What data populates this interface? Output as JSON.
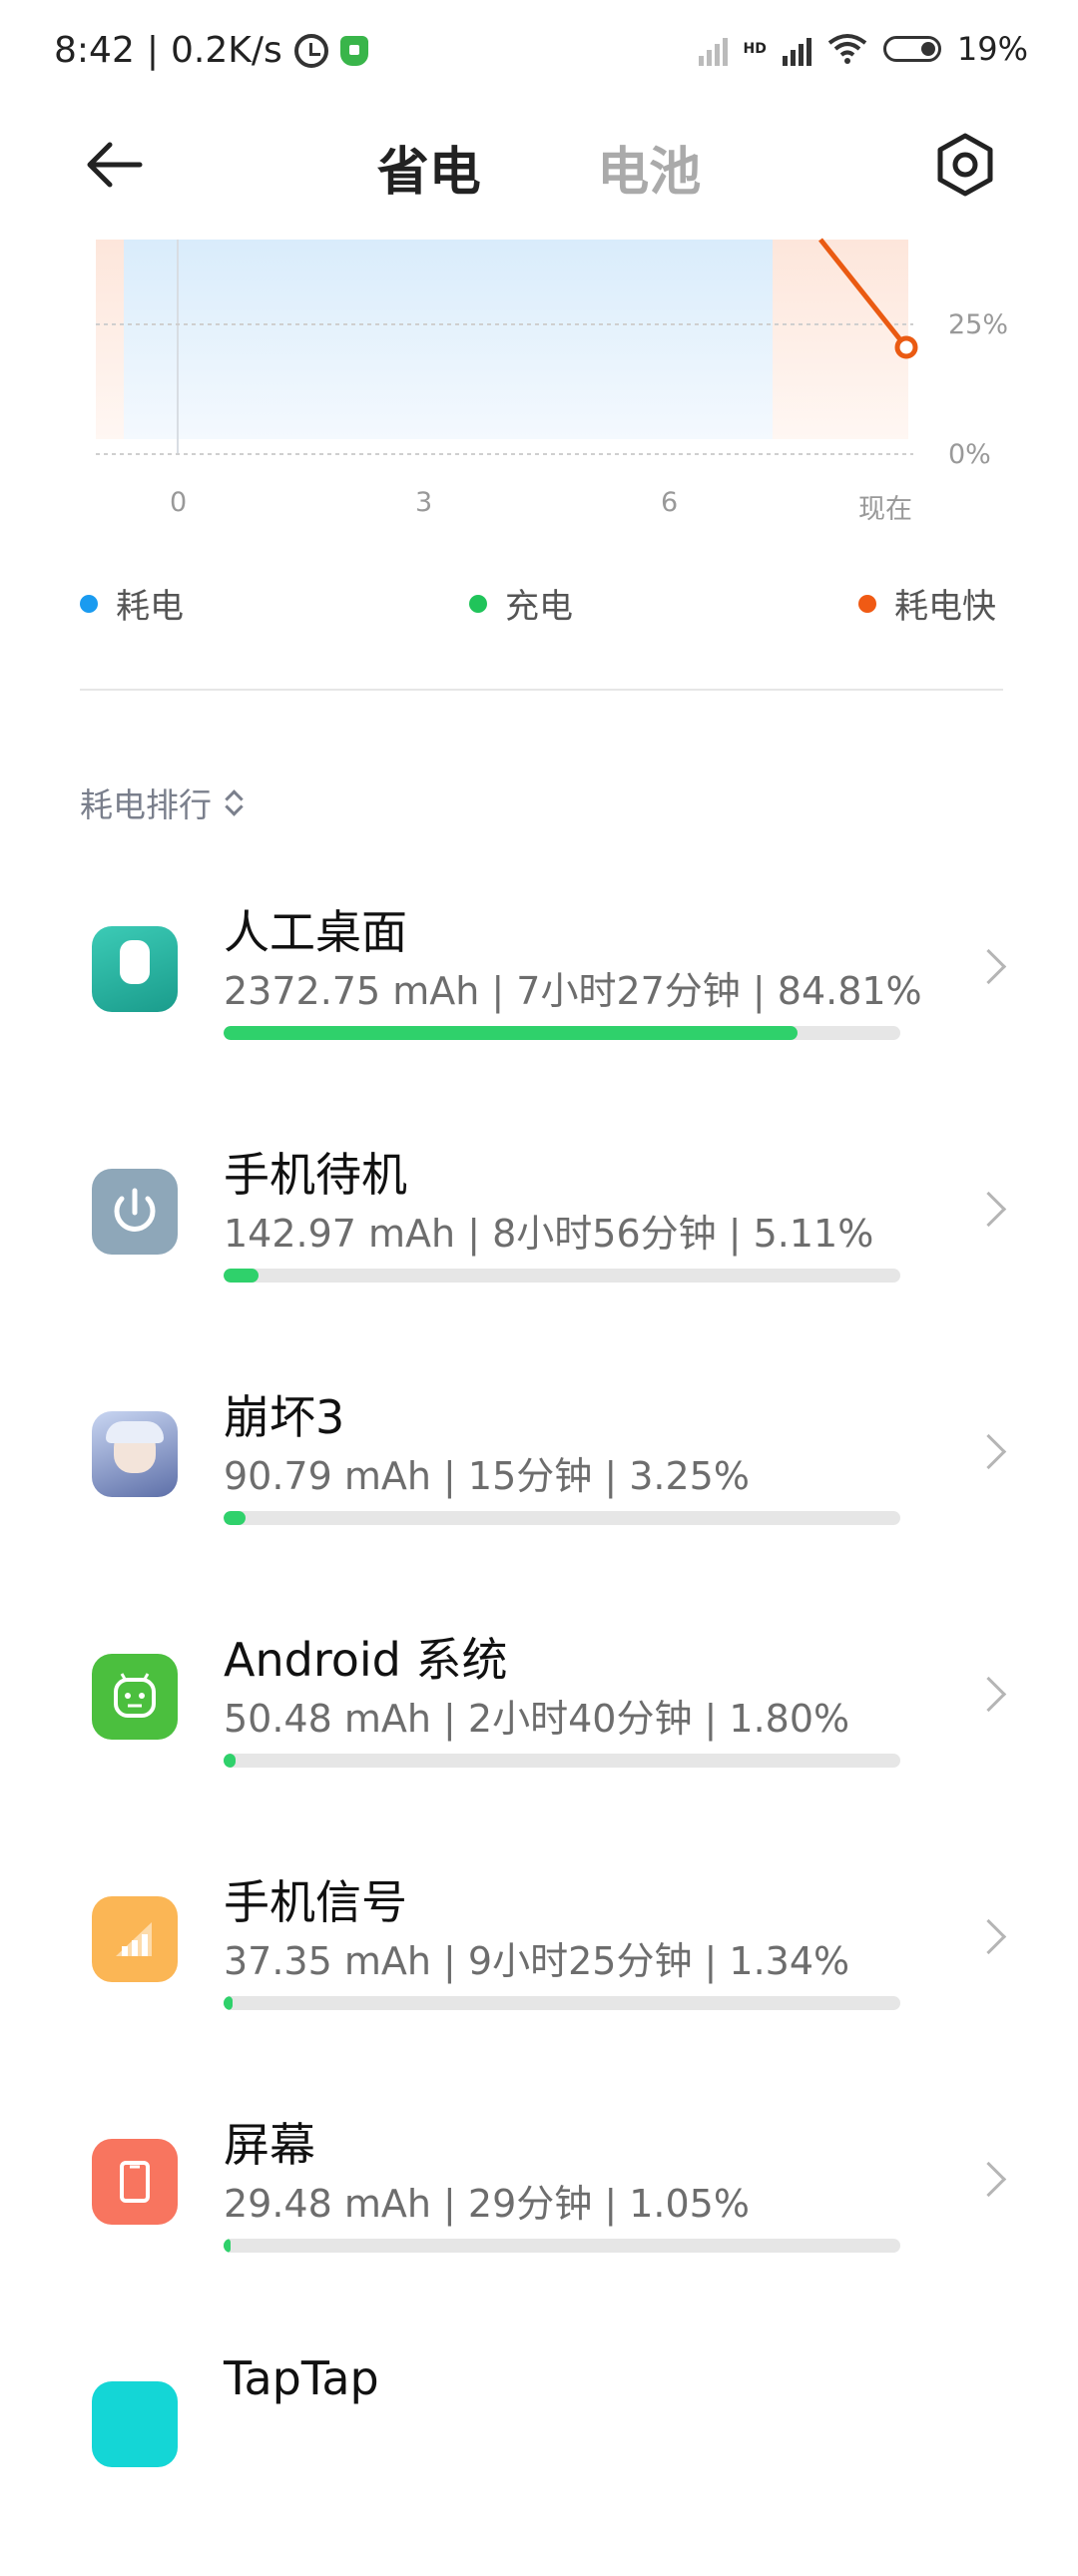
{
  "status_bar": {
    "time": "8:42",
    "speed": "0.2K/s",
    "battery": "19%",
    "signal_badge": "HD"
  },
  "header": {
    "tab_saving": "省电",
    "tab_battery": "电池",
    "back_icon": "arrow-left-icon",
    "settings_icon": "gear-icon"
  },
  "chart": {
    "y_labels": [
      "25%",
      "0%"
    ],
    "x_labels": [
      "0",
      "3",
      "6",
      "现在"
    ]
  },
  "legend": {
    "drain": "耗电",
    "charge": "充电",
    "fast_drain": "耗电快",
    "colors": {
      "drain": "#1a9bf0",
      "charge": "#20c45a",
      "fast_drain": "#f05a14"
    }
  },
  "ranking": {
    "title": "耗电排行"
  },
  "apps": [
    {
      "name": "人工桌面",
      "stat": "2372.75 mAh | 7小时27分钟 | 84.81%",
      "percent": 84.81,
      "icon": "desktop-app-icon",
      "color": "#27b5a3"
    },
    {
      "name": "手机待机",
      "stat": "142.97 mAh | 8小时56分钟 | 5.11%",
      "percent": 5.11,
      "icon": "power-icon",
      "color": "#8ea7b9"
    },
    {
      "name": "崩坏3",
      "stat": "90.79 mAh | 15分钟 | 3.25%",
      "percent": 3.25,
      "icon": "game-avatar-icon",
      "color": "#6b7fb4"
    },
    {
      "name": "Android 系统",
      "stat": "50.48 mAh | 2小时40分钟 | 1.80%",
      "percent": 1.8,
      "icon": "android-icon",
      "color": "#4bbf3e"
    },
    {
      "name": "手机信号",
      "stat": "37.35 mAh | 9小时25分钟 | 1.34%",
      "percent": 1.34,
      "icon": "signal-icon",
      "color": "#fbb655"
    },
    {
      "name": "屏幕",
      "stat": "29.48 mAh | 29分钟 | 1.05%",
      "percent": 1.05,
      "icon": "screen-icon",
      "color": "#f8755f"
    },
    {
      "name": "TapTap",
      "stat": "",
      "percent": 0,
      "icon": "taptap-icon",
      "color": "#14d6d6"
    }
  ]
}
